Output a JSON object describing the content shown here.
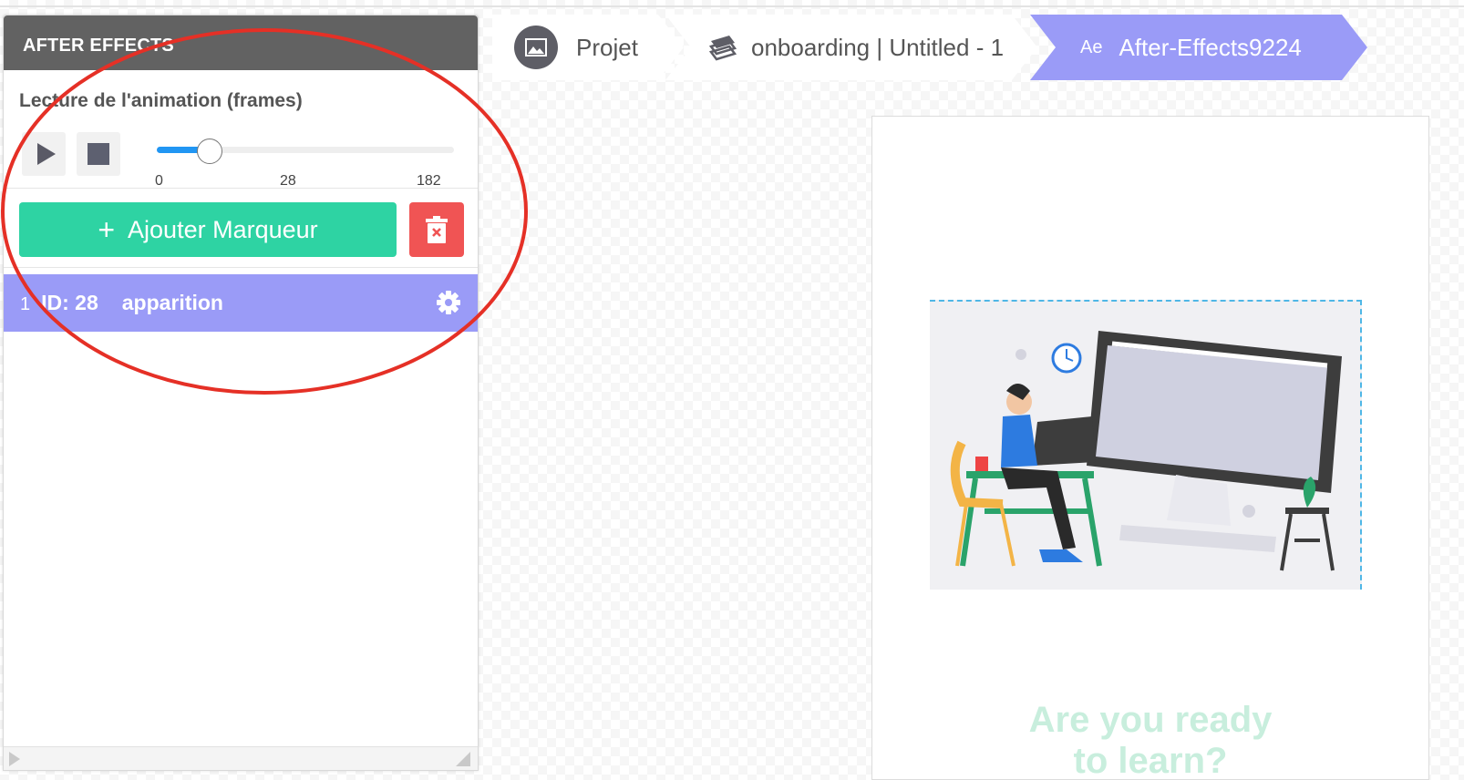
{
  "panel": {
    "title": "AFTER EFFECTS",
    "section_label": "Lecture de l'animation (frames)",
    "slider": {
      "min_label": "0",
      "current_label": "28",
      "max_label": "182",
      "value": 28,
      "max": 182
    },
    "add_marker_label": "Ajouter Marqueur",
    "markers": [
      {
        "index": "1",
        "id_text": "ID: 28",
        "name": "apparition"
      }
    ]
  },
  "breadcrumb": {
    "project": "Projet",
    "composition": "onboarding | Untitled - 1",
    "ae_prefix": "Ae",
    "layer": "After-Effects9224"
  },
  "canvas": {
    "headline_line1": "Are you ready",
    "headline_line2": "to learn?"
  },
  "colors": {
    "header": "#626262",
    "accent_green": "#2ed3a3",
    "delete_red": "#f05454",
    "marker_purple": "#9a9bf7",
    "slider_blue": "#2196f3",
    "annotation_red": "#e53026"
  }
}
